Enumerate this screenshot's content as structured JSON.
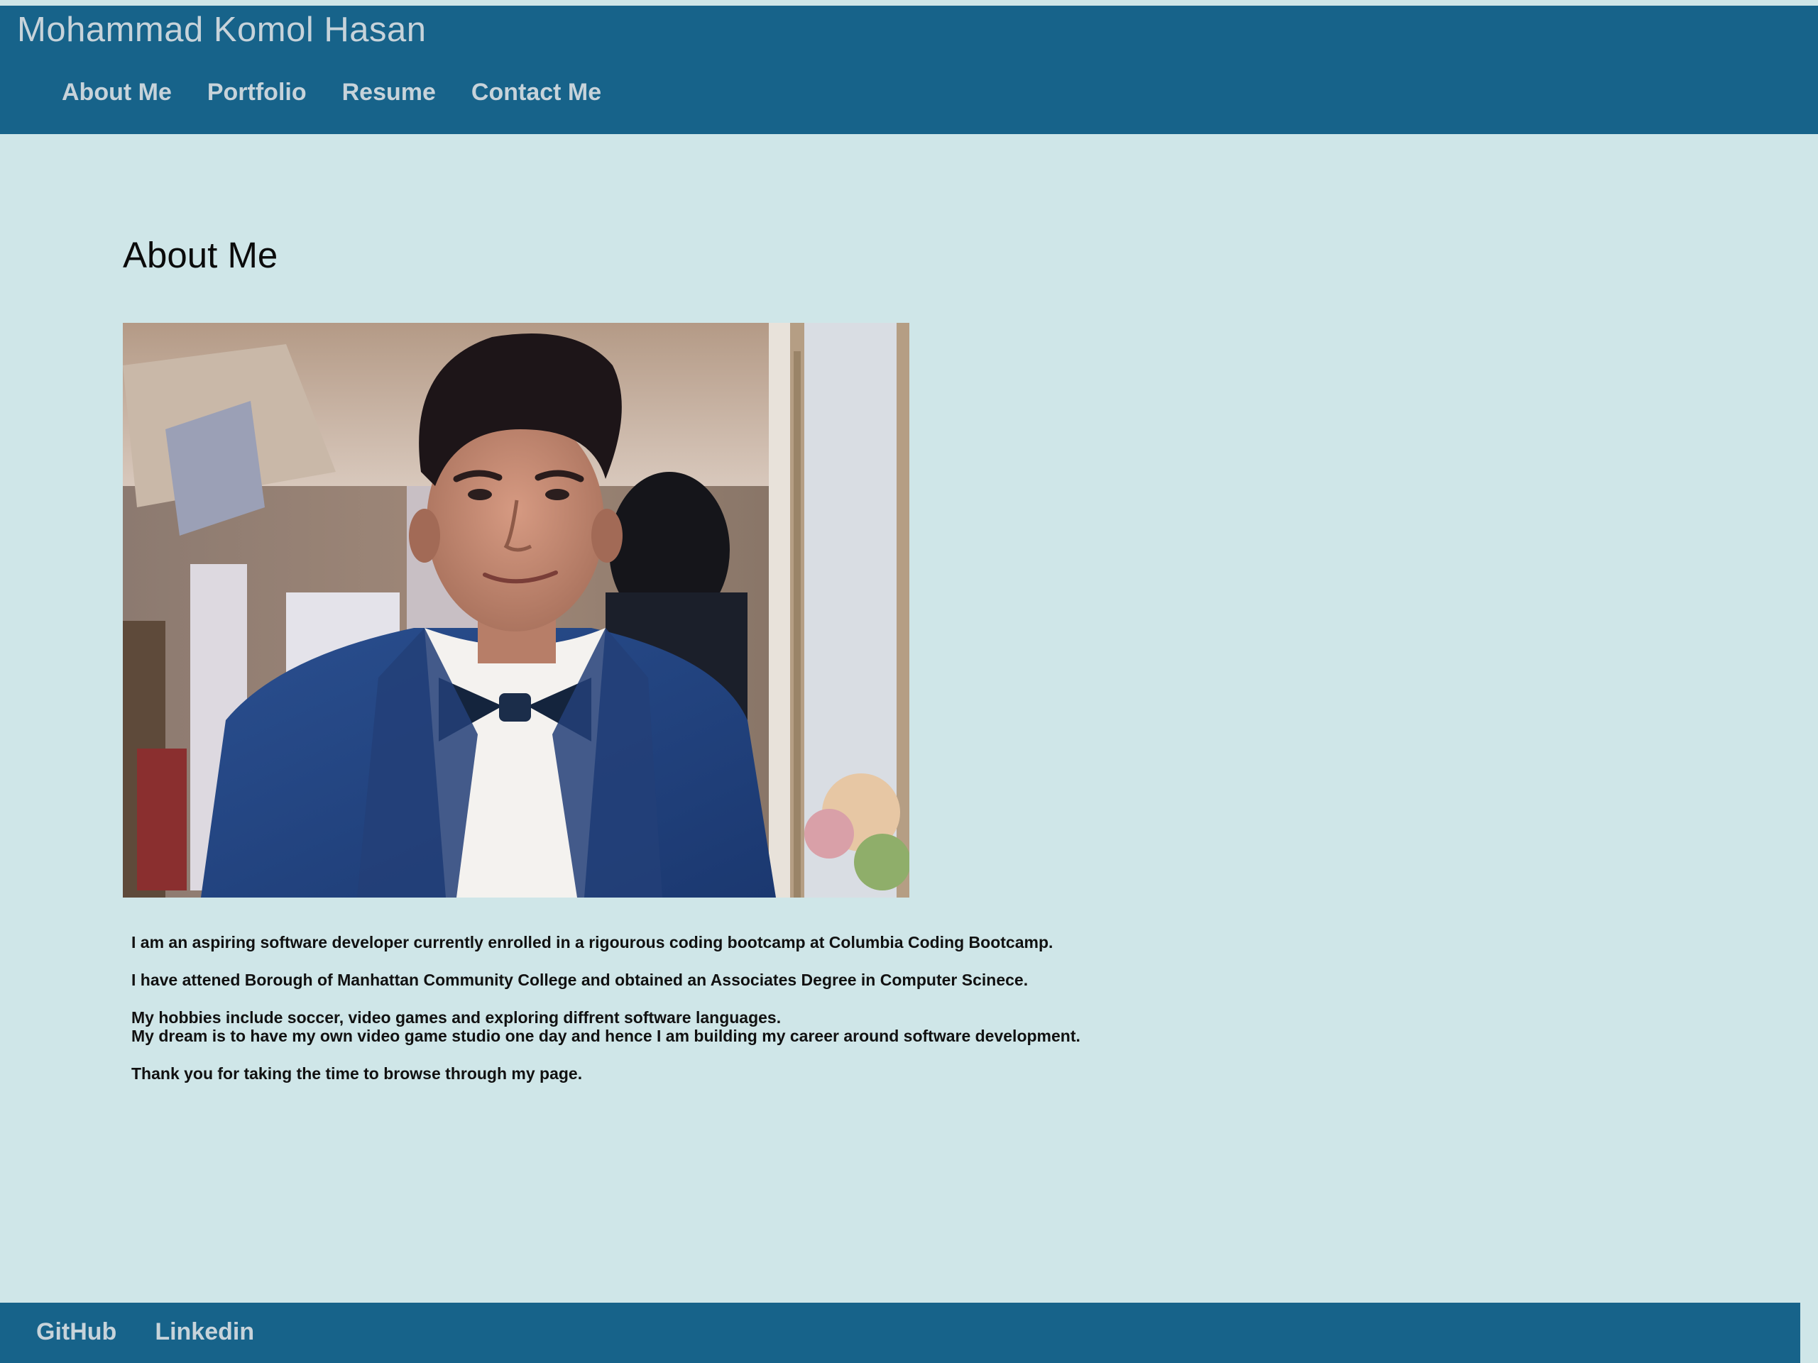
{
  "header": {
    "site_title": "Mohammad Komol Hasan",
    "nav": [
      {
        "label": "About Me"
      },
      {
        "label": "Portfolio"
      },
      {
        "label": "Resume"
      },
      {
        "label": "Contact Me"
      }
    ]
  },
  "main": {
    "heading": "About Me",
    "photo_alt": "Portrait of Mohammad Komol Hasan",
    "bio": [
      "I am an aspiring software developer currently enrolled in a rigourous coding bootcamp at Columbia Coding Bootcamp.",
      "I have attened Borough of Manhattan Community College and obtained an Associates Degree in Computer Scinece.",
      "My hobbies include soccer, video games and exploring diffrent software languages.",
      "My dream is to have my own video game studio one day and hence I am building my career around software development.",
      "Thank you for taking the time to browse through my page."
    ]
  },
  "footer": {
    "links": [
      {
        "label": "GitHub"
      },
      {
        "label": "Linkedin"
      }
    ]
  },
  "colors": {
    "header_bg": "#17638a",
    "page_bg": "#cfe6e8",
    "nav_text": "#c7d3da"
  }
}
